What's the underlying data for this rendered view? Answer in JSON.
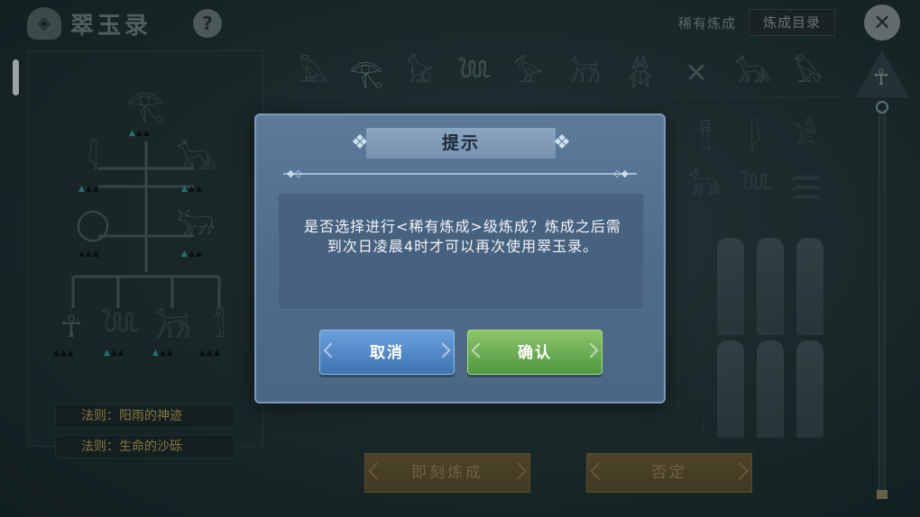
{
  "header": {
    "app_title": "翠玉录",
    "help_label": "?",
    "rarity_label": "稀有炼成",
    "catalog_button": "炼成目录",
    "close_symbol": "✕"
  },
  "left_panel": {
    "laws": [
      {
        "label": "法则：阳雨的神迹"
      },
      {
        "label": "法则：生命的沙砾"
      }
    ]
  },
  "actions": {
    "engrave": "即刻炼成",
    "deny": "否定"
  },
  "dialog": {
    "title": "提示",
    "message": "是否选择进行<稀有炼成>级炼成？炼成之后需到次日凌晨4时才可以再次使用翠玉录。",
    "cancel": "取消",
    "confirm": "确认"
  },
  "colors": {
    "dialog_bg": "#5d7a9b",
    "cancel_btn": "#3f74b3",
    "confirm_btn": "#4f9840",
    "law_text": "#b6a45a",
    "active_triangle": "#2da49a"
  }
}
